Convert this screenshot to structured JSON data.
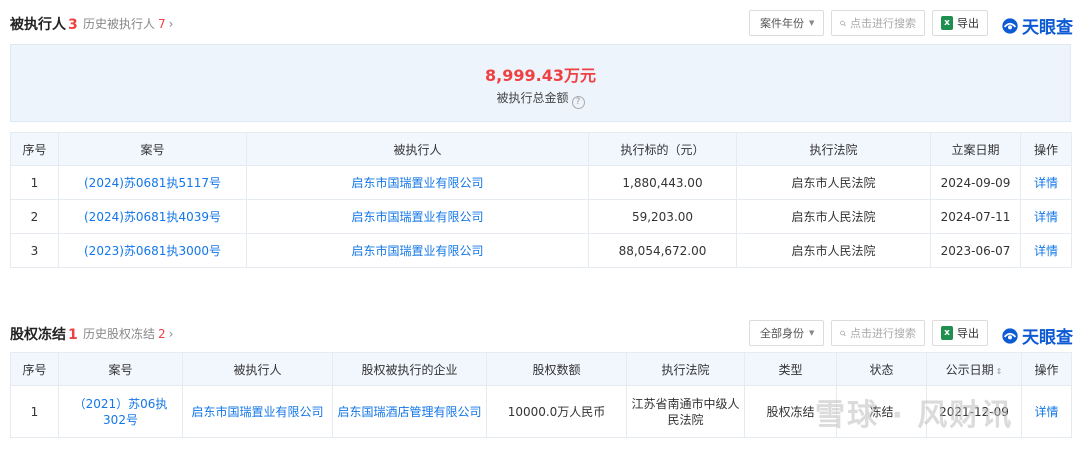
{
  "section1": {
    "title": "被执行人",
    "count": "3",
    "history_label": "历史被执行人",
    "history_count": "7",
    "history_chevron": "›",
    "dropdown_label": "案件年份",
    "search_placeholder": "点击进行搜索",
    "export_label": "导出",
    "logo_text": "天眼查",
    "summary_amount": "8,999.43万元",
    "summary_label": "被执行总金额",
    "summary_help": "?",
    "columns": [
      "序号",
      "案号",
      "被执行人",
      "执行标的（元）",
      "执行法院",
      "立案日期",
      "操作"
    ],
    "rows": [
      {
        "no": "1",
        "case_no": "(2024)苏0681执5117号",
        "party": "启东市国瑞置业有限公司",
        "amount": "1,880,443.00",
        "court": "启东市人民法院",
        "date": "2024-09-09",
        "action": "详情"
      },
      {
        "no": "2",
        "case_no": "(2024)苏0681执4039号",
        "party": "启东市国瑞置业有限公司",
        "amount": "59,203.00",
        "court": "启东市人民法院",
        "date": "2024-07-11",
        "action": "详情"
      },
      {
        "no": "3",
        "case_no": "(2023)苏0681执3000号",
        "party": "启东市国瑞置业有限公司",
        "amount": "88,054,672.00",
        "court": "启东市人民法院",
        "date": "2023-06-07",
        "action": "详情"
      }
    ]
  },
  "section2": {
    "title": "股权冻结",
    "count": "1",
    "history_label": "历史股权冻结",
    "history_count": "2",
    "history_chevron": "›",
    "dropdown_label": "全部身份",
    "search_placeholder": "点击进行搜索",
    "export_label": "导出",
    "logo_text": "天眼查",
    "columns": [
      "序号",
      "案号",
      "被执行人",
      "股权被执行的企业",
      "股权数额",
      "执行法院",
      "类型",
      "状态",
      "公示日期",
      "操作"
    ],
    "sort_icon": "⇕",
    "rows": [
      {
        "no": "1",
        "case_no": "（2021）苏06执302号",
        "party": "启东市国瑞置业有限公司",
        "company": "启东国瑞酒店管理有限公司",
        "equity": "10000.0万人民币",
        "court": "江苏省南通市中级人民法院",
        "type": "股权冻结",
        "status": "冻结",
        "date": "2021-12-09",
        "action": "详情"
      }
    ]
  },
  "watermark": "雪球 · 风财讯",
  "colors": {
    "accent_red": "#f04142",
    "link_blue": "#1377e8",
    "logo_blue": "#0d5bd4",
    "header_bg": "#f2f7fe",
    "summary_bg": "#eef4fc"
  }
}
